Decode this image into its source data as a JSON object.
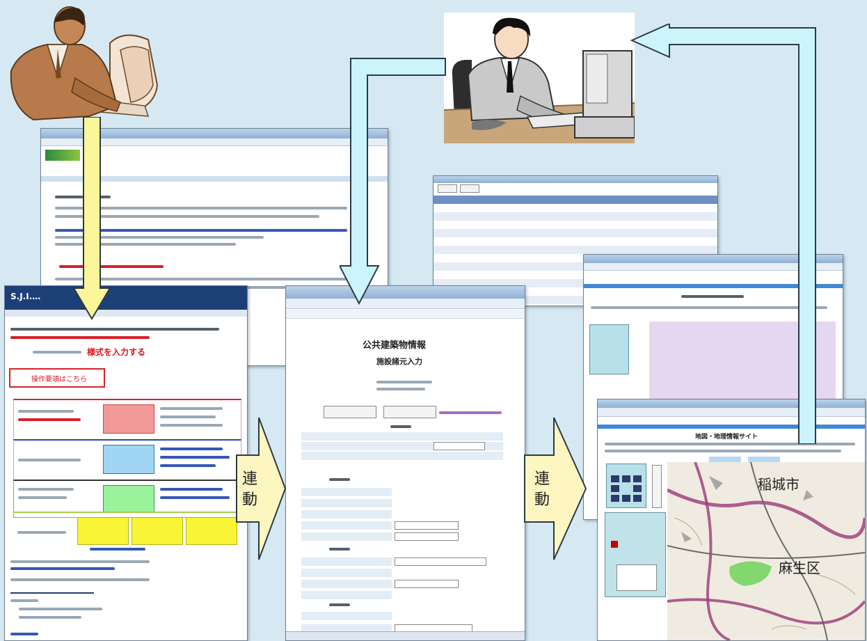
{
  "arrows": {
    "link_label_1": "連動",
    "link_label_2": "連動"
  },
  "left_page": {
    "header_title": "S.J.I.…",
    "highlight_button_text": "様式を入力する",
    "red_line": "様式を入力する",
    "notice_text": "操作要領はこちら"
  },
  "middle_window": {
    "title": "公共建築物情報",
    "subtitle": "施設諸元入力"
  },
  "right_map": {
    "title": "地図・地理情報サイト",
    "city_1": "稲城市",
    "city_2": "麻生区"
  },
  "colors": {
    "arrow_fill": "#ccf5fb",
    "arrow_stroke": "#2b3a46",
    "link_arrow_fill": "#fdf6c0",
    "background": "#d6e9f3",
    "yellow_arrow_fill": "#fbf69a"
  }
}
